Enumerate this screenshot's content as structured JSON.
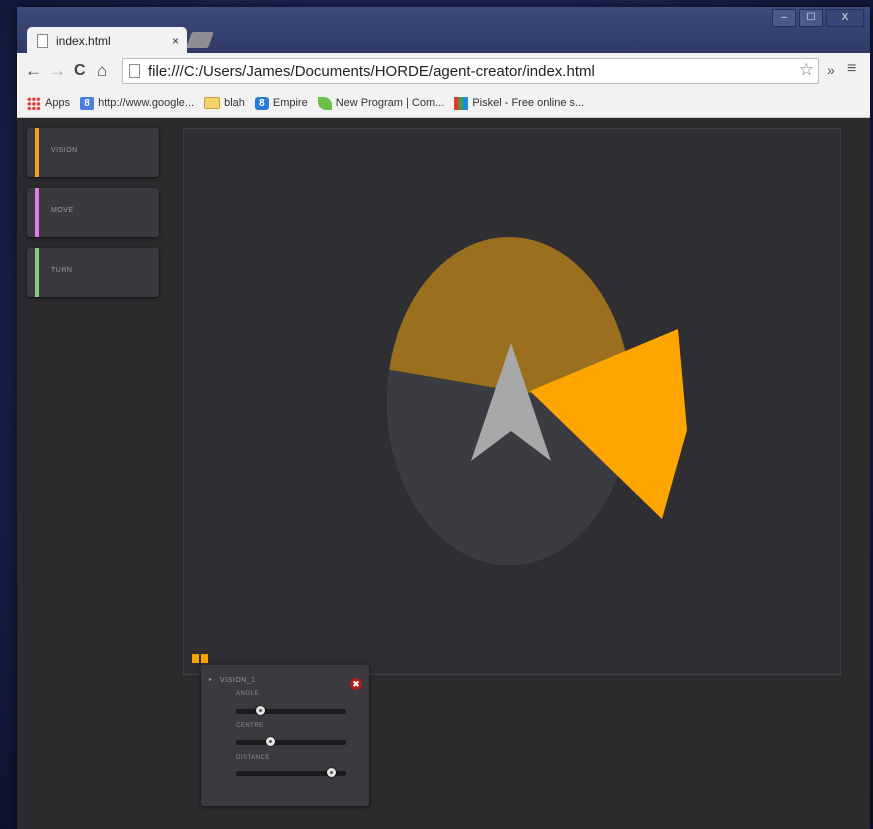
{
  "browser": {
    "tab_title": "index.html",
    "tab_close": "×",
    "window_controls": {
      "minimize": "‒",
      "maximize": "☐",
      "close": "X"
    },
    "nav": {
      "back": "←",
      "forward": "→",
      "reload": "C",
      "home": "⌂"
    },
    "url": "file:///C:/Users/James/Documents/HORDE/agent-creator/index.html",
    "extensions_label": "»",
    "menu_label": "≡",
    "bookmarks": [
      {
        "label": "Apps",
        "icon": "apps-icon"
      },
      {
        "label": "http://www.google...",
        "icon": "google-icon"
      },
      {
        "label": "blah",
        "icon": "folder-icon"
      },
      {
        "label": "Empire",
        "icon": "empire-icon"
      },
      {
        "label": "New Program | Com...",
        "icon": "leaf-icon"
      },
      {
        "label": "Piskel - Free online s...",
        "icon": "grid-icon"
      }
    ]
  },
  "sidebar": {
    "items": [
      {
        "label": "VISION",
        "color": "#f0a323"
      },
      {
        "label": "MOVE",
        "color": "#e07ce8"
      },
      {
        "label": "TURN",
        "color": "#7ed27a"
      }
    ]
  },
  "canvas": {
    "colors": {
      "background": "#2f2e33",
      "circle_upper": "#9a6f1e",
      "circle_lower": "#3a3c42",
      "vision_wedge": "#ffa500",
      "agent": "#a8a8a8"
    }
  },
  "indicators": {
    "color": "#f5a100",
    "count": 2
  },
  "panel": {
    "collapse_icon": "▸",
    "title": "VISION_1",
    "close_icon": "✖",
    "sliders": [
      {
        "label": "ANGLE",
        "value": 0.2
      },
      {
        "label": "CENTRE",
        "value": 0.3
      },
      {
        "label": "DISTANCE",
        "value": 0.9
      }
    ]
  }
}
